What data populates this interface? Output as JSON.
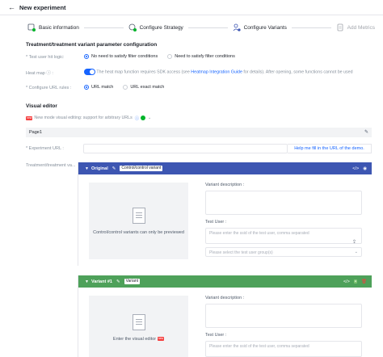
{
  "header": {
    "title": "New experiment"
  },
  "steps": [
    {
      "label": "Basic information"
    },
    {
      "label": "Configure Strategy"
    },
    {
      "label": "Configure Variants"
    },
    {
      "label": "Add Metrics"
    }
  ],
  "treatment": {
    "title": "Treatment/treatment variant parameter configuration",
    "test_user_label": "* Test user hit logic:",
    "test_user_options": [
      "No need to satisfy filter conditions",
      "Need to satisfy filter conditions"
    ],
    "heat_map_label": "Heat map ⓘ :",
    "heat_map_text_1": "The heat map function requires SDK access (see",
    "heat_map_link": "Heatmap Integration Guide",
    "heat_map_text_2": "for details). After opening, some functions cannot be used",
    "url_rules_label": "* Configure URL rules :",
    "url_rule_options": [
      "URL match",
      "URL exact match"
    ]
  },
  "visual_editor": {
    "title": "Visual editor",
    "new_badge": "new",
    "notice": "New mode visual editing: support for arbitrary URLs",
    "page_name": "Page1",
    "experiment_url_label": "* Experiment URL :",
    "fill_link": "Help me fill in the URL of the demo.",
    "variants_label": "Treatment/treatment va..."
  },
  "variants": [
    {
      "name": "Original",
      "tag": "Control/control variant",
      "preview_text": "Control/control variants can only be previewed",
      "description_label": "Variant description :",
      "test_user_label": "Test User :",
      "test_user_placeholder": "Please enter the ssid of the test user, comma separated",
      "group_placeholder": "Please select the test user group(s)"
    },
    {
      "name": "Variant #1",
      "tag": "Variant",
      "new_badge": "new",
      "preview_text": "Enter the visual editor",
      "description_label": "Variant description :",
      "test_user_label": "Test User :",
      "test_user_placeholder": "Please enter the ssid of the test user, comma separated"
    }
  ],
  "colors": {
    "primary": "#1664ff",
    "control_header": "#3d56b2",
    "variant_header": "#4ea15a",
    "danger": "#f53f3f"
  }
}
